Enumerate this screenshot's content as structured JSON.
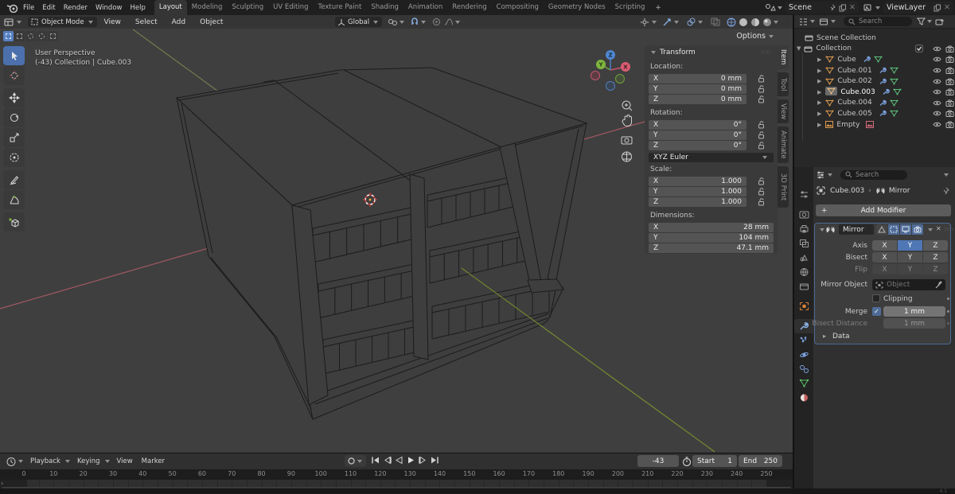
{
  "topbar": {
    "menus": [
      "File",
      "Edit",
      "Render",
      "Window",
      "Help"
    ],
    "tabs": [
      "Layout",
      "Modeling",
      "Sculpting",
      "UV Editing",
      "Texture Paint",
      "Shading",
      "Animation",
      "Rendering",
      "Compositing",
      "Geometry Nodes",
      "Scripting"
    ],
    "active_tab": "Layout",
    "add_tab_label": "+",
    "scene_label": "Scene",
    "view_layer_label": "ViewLayer"
  },
  "viewport_header": {
    "mode": "Object Mode",
    "menus": [
      "View",
      "Select",
      "Add",
      "Object"
    ],
    "orientation": "Global"
  },
  "tool_settings": {
    "options_label": "Options"
  },
  "viewport": {
    "view_label": "User Perspective",
    "context_label": "(-43) Collection | Cube.003",
    "gizmo_axes": [
      "X",
      "Y",
      "Z"
    ]
  },
  "n_panel": {
    "title": "Transform",
    "tabs": [
      "Item",
      "Tool",
      "View",
      "Animate",
      "3D Print"
    ],
    "active_tab": "Item",
    "groups": [
      {
        "label": "Location:",
        "rows": [
          [
            "X",
            "0 mm"
          ],
          [
            "Y",
            "0 mm"
          ],
          [
            "Z",
            "0 mm"
          ]
        ],
        "locks": true
      },
      {
        "label": "Rotation:",
        "rows": [
          [
            "X",
            "0°"
          ],
          [
            "Y",
            "0°"
          ],
          [
            "Z",
            "0°"
          ]
        ],
        "locks": true,
        "after": "XYZ Euler"
      },
      {
        "label": "Scale:",
        "rows": [
          [
            "X",
            "1.000"
          ],
          [
            "Y",
            "1.000"
          ],
          [
            "Z",
            "1.000"
          ]
        ],
        "locks": true
      },
      {
        "label": "Dimensions:",
        "rows": [
          [
            "X",
            "28 mm"
          ],
          [
            "Y",
            "104 mm"
          ],
          [
            "Z",
            "47.1 mm"
          ]
        ],
        "locks": false
      }
    ]
  },
  "outliner": {
    "search_placeholder": "Search",
    "rows": [
      {
        "label": "Scene Collection",
        "type": "scene"
      },
      {
        "label": "Collection",
        "type": "collection"
      },
      {
        "label": "Cube",
        "type": "mesh"
      },
      {
        "label": "Cube.001",
        "type": "mesh"
      },
      {
        "label": "Cube.002",
        "type": "mesh"
      },
      {
        "label": "Cube.003",
        "type": "mesh",
        "active": true
      },
      {
        "label": "Cube.004",
        "type": "mesh"
      },
      {
        "label": "Cube.005",
        "type": "mesh"
      },
      {
        "label": "Empty",
        "type": "empty"
      }
    ]
  },
  "properties": {
    "search_placeholder": "Search",
    "breadcrumb": [
      "Cube.003",
      "Mirror"
    ],
    "add_modifier_label": "Add Modifier",
    "modifier": {
      "name": "Mirror",
      "axis_label": "Axis",
      "bisect_label": "Bisect",
      "flip_label": "Flip",
      "axes": [
        "X",
        "Y",
        "Z"
      ],
      "axis_active": "Y",
      "mirror_object_label": "Mirror Object",
      "mirror_object_placeholder": "Object",
      "clipping_label": "Clipping",
      "merge_label": "Merge",
      "merge_value": "1 mm",
      "bisect_distance_label": "Bisect Distance",
      "bisect_distance_value": "1 mm",
      "data_label": "Data"
    }
  },
  "timeline": {
    "menus": [
      "Playback",
      "Keying",
      "View",
      "Marker"
    ],
    "current_frame": "-43",
    "start_label": "Start",
    "start_value": "1",
    "end_label": "End",
    "end_value": "250",
    "ruler_start": 0,
    "ruler_end": 250,
    "ruler_step": 10
  }
}
